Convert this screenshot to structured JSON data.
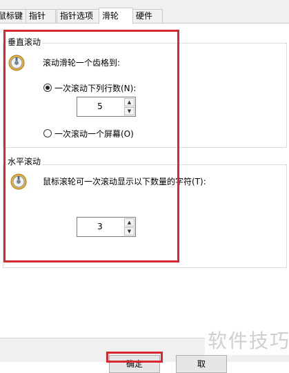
{
  "tabs": [
    {
      "label": "鼠标键"
    },
    {
      "label": "指针"
    },
    {
      "label": "指针选项"
    },
    {
      "label": "滑轮",
      "active": true
    },
    {
      "label": "硬件"
    }
  ],
  "vertical": {
    "title": "垂直滚动",
    "prompt": "滚动滑轮一个齿格到:",
    "option_lines_label": "一次滚动下列行数(N):",
    "lines_value": "5",
    "option_screen_label": "一次滚动一个屏幕(O)"
  },
  "horizontal": {
    "title": "水平滚动",
    "prompt": "鼠标滚轮可一次滚动显示以下数量的字符(T):",
    "chars_value": "3"
  },
  "footer": {
    "ok_label": "确定",
    "cancel_label": "取"
  },
  "watermark": "软件技巧",
  "colors": {
    "highlight": "#d9262f"
  },
  "icons": {
    "spin_up": "▲",
    "spin_down": "▼"
  }
}
